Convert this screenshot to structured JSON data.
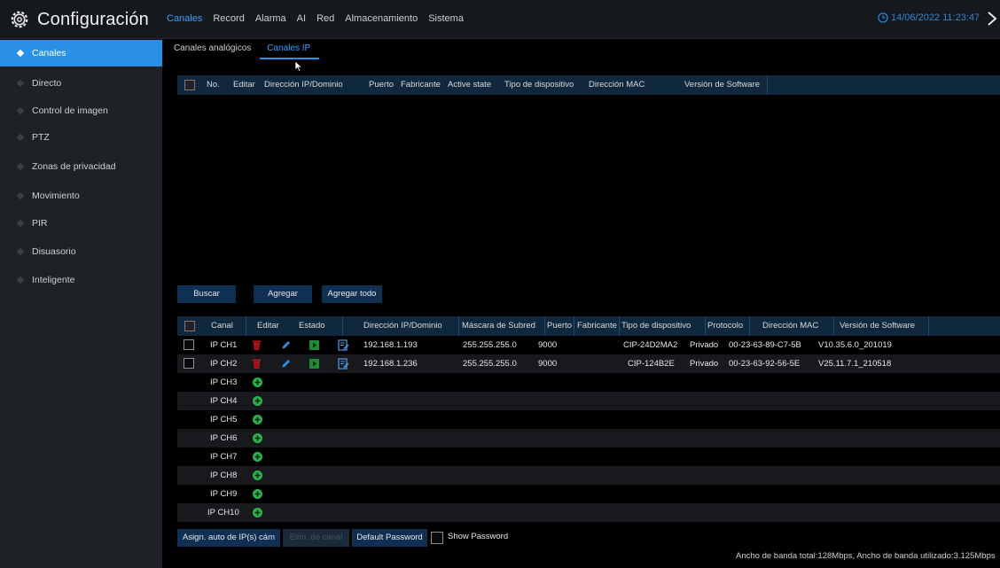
{
  "app": {
    "title": "Configuración"
  },
  "main_tabs": [
    "Canales",
    "Record",
    "Alarma",
    "AI",
    "Red",
    "Almacenamiento",
    "Sistema"
  ],
  "datetime": "14/06/2022 11:23:47",
  "sidebar": {
    "items": [
      "Canales",
      "Directo",
      "Control de imagen",
      "PTZ",
      "Zonas de privacidad",
      "Movimiento",
      "PIR",
      "Disuasorio",
      "Inteligente"
    ]
  },
  "sub_tabs": [
    "Canales analógicos",
    "Canales IP"
  ],
  "search_table": {
    "headers": [
      "No.",
      "Editar",
      "Dirección IP/Dominio",
      "Puerto",
      "Fabricante",
      "Active state",
      "Tipo de dispositivo",
      "Dirección MAC",
      "Versión de Software"
    ]
  },
  "buttons": {
    "buscar": "Buscar",
    "agregar": "Agregar",
    "agregar_todo": "Agregar todo",
    "asign_auto": "Asign. auto de IP(s) cám",
    "elim_canal": "Elim. de canal",
    "default_password": "Default Password",
    "show_password": "Show Password"
  },
  "channel_table": {
    "headers": [
      "Canal",
      "Editar",
      "Estado",
      "Dirección IP/Dominio",
      "Máscara de Subred",
      "Puerto",
      "Fabricante",
      "Tipo de dispositivo",
      "Protocolo",
      "Dirección MAC",
      "Versión de Software"
    ],
    "rows": [
      {
        "canal": "IP CH1",
        "ip": "192.168.1.193",
        "mask": "255.255.255.0",
        "port": "9000",
        "type": "CIP-24D2MA2",
        "protocol": "Privado",
        "mac": "00-23-63-89-C7-5B",
        "version": "V10.35.6.0_201019"
      },
      {
        "canal": "IP CH2",
        "ip": "192.168.1.236",
        "mask": "255.255.255.0",
        "port": "9000",
        "type": "CIP-124B2E",
        "protocol": "Privado",
        "mac": "00-23-63-92-56-5E",
        "version": "V25.11.7.1_210518"
      },
      {
        "canal": "IP CH3"
      },
      {
        "canal": "IP CH4"
      },
      {
        "canal": "IP CH5"
      },
      {
        "canal": "IP CH6"
      },
      {
        "canal": "IP CH7"
      },
      {
        "canal": "IP CH8"
      },
      {
        "canal": "IP CH9"
      },
      {
        "canal": "IP CH10"
      }
    ]
  },
  "bandwidth": "Ancho de banda total:128Mbps, Ancho de banda utilizado:3.125Mbps",
  "colors": {
    "accent": "#2a8fe6",
    "header_bg": "#10283e",
    "sidebar_bg": "#1e2227",
    "delete_red": "#c0171e",
    "add_green": "#2bb24c"
  }
}
